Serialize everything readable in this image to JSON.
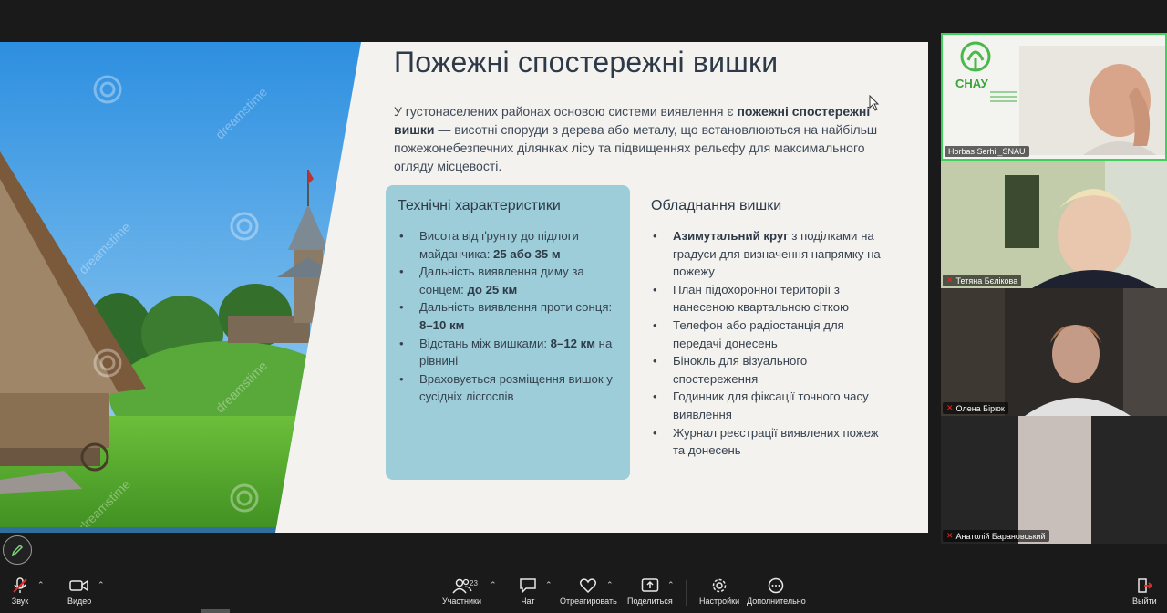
{
  "slide": {
    "title": "Пожежні спостережні вишки",
    "intro_part1": "У густонаселених районах основою системи виявлення є ",
    "intro_bold": "пожежні спостережні вишки",
    "intro_part2": " — висотні споруди з дерева або металу, що встановлюються на найбільш пожежонебезпечних ділянках лісу та підвищеннях рельєфу для максимального огляду місцевості.",
    "watermark": "dreamstime",
    "specs": {
      "title": "Технічні характеристики",
      "items": [
        {
          "text": "Висота від ґрунту до підлоги майданчика: ",
          "bold": "25 або 35 м",
          "tail": ""
        },
        {
          "text": "Дальність виявлення диму за сонцем: ",
          "bold": "до 25 км",
          "tail": ""
        },
        {
          "text": "Дальність виявлення проти сонця: ",
          "bold": "8–10 км",
          "tail": ""
        },
        {
          "text": "Відстань між вишками: ",
          "bold": "8–12 км",
          "tail": " на рівнині"
        },
        {
          "text": "Враховується розміщення вишок у сусідніх лісгоспів",
          "bold": "",
          "tail": ""
        }
      ]
    },
    "equipment": {
      "title": "Обладнання вишки",
      "items": [
        {
          "text": "",
          "bold": "Азимутальний круг",
          "tail": " з поділками на градуси для визначення напрямку на пожежу"
        },
        {
          "text": "План підохоронної території з нанесеною квартальною сіткою",
          "bold": "",
          "tail": ""
        },
        {
          "text": "Телефон або радіостанція для передачі донесень",
          "bold": "",
          "tail": ""
        },
        {
          "text": "Бінокль для візуального спостереження",
          "bold": "",
          "tail": ""
        },
        {
          "text": "Годинник для фіксації точного часу виявлення",
          "bold": "",
          "tail": ""
        },
        {
          "text": "Журнал реєстрації виявлених пожеж та донесень",
          "bold": "",
          "tail": ""
        }
      ]
    }
  },
  "participants": [
    {
      "name": "Horbas Serhii_SNAU",
      "active": true,
      "muted": false,
      "logo": "СНАУ"
    },
    {
      "name": "Тетяна Бєлікова",
      "active": false,
      "muted": true
    },
    {
      "name": "Олена Бірюк",
      "active": false,
      "muted": true
    },
    {
      "name": "Анатолій Барановський",
      "active": false,
      "muted": true
    }
  ],
  "toolbar": {
    "audio": "Звук",
    "video": "Видео",
    "participants": "Участники",
    "participants_count": "23",
    "chat": "Чат",
    "react": "Отреагировать",
    "share": "Поделиться",
    "settings": "Настройки",
    "more": "Дополнительно",
    "leave": "Выйти"
  },
  "colors": {
    "card": "#9dcdd8",
    "active_border": "#3fd15c",
    "muted": "#e02b2b"
  }
}
